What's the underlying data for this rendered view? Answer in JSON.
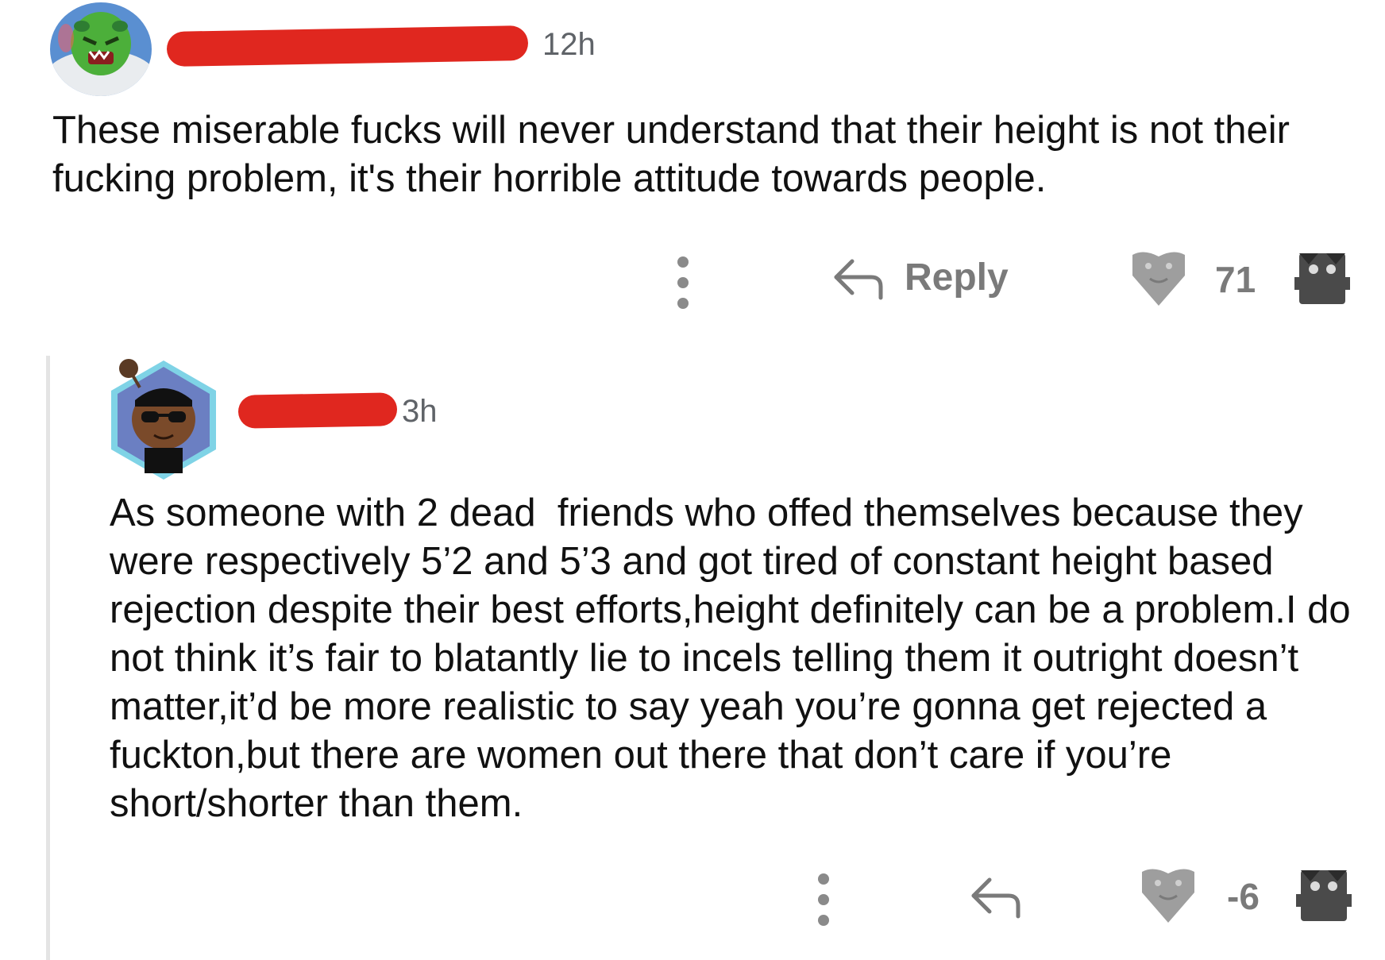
{
  "comments": [
    {
      "time": "12h",
      "body": "These miserable fucks will never understand that their height is not their fucking problem, it's their horrible attitude towards people.",
      "reply_label": "Reply",
      "score": "71",
      "icons": [
        "more-icon",
        "reply-icon",
        "heart-upvote-icon",
        "robot-downvote-icon"
      ]
    },
    {
      "time": "3h",
      "body": "As someone with 2 dead  friends who offed themselves because they were respectively 5’2 and 5’3 and got tired of constant height based rejection despite their best efforts,height definitely can be a problem.I do not think it’s fair to blatantly lie to incels telling them it outright doesn’t matter,it’d be more realistic to say yeah you’re gonna get rejected a fuckton,but there are women out there that don’t care if you’re short/shorter than them.",
      "score": "-6",
      "icons": [
        "more-icon",
        "reply-icon",
        "heart-upvote-icon",
        "robot-downvote-icon"
      ]
    }
  ],
  "colors": {
    "redaction": "#e0271f",
    "muted": "#7a7a7a",
    "thread_line": "#e4e4e4"
  }
}
